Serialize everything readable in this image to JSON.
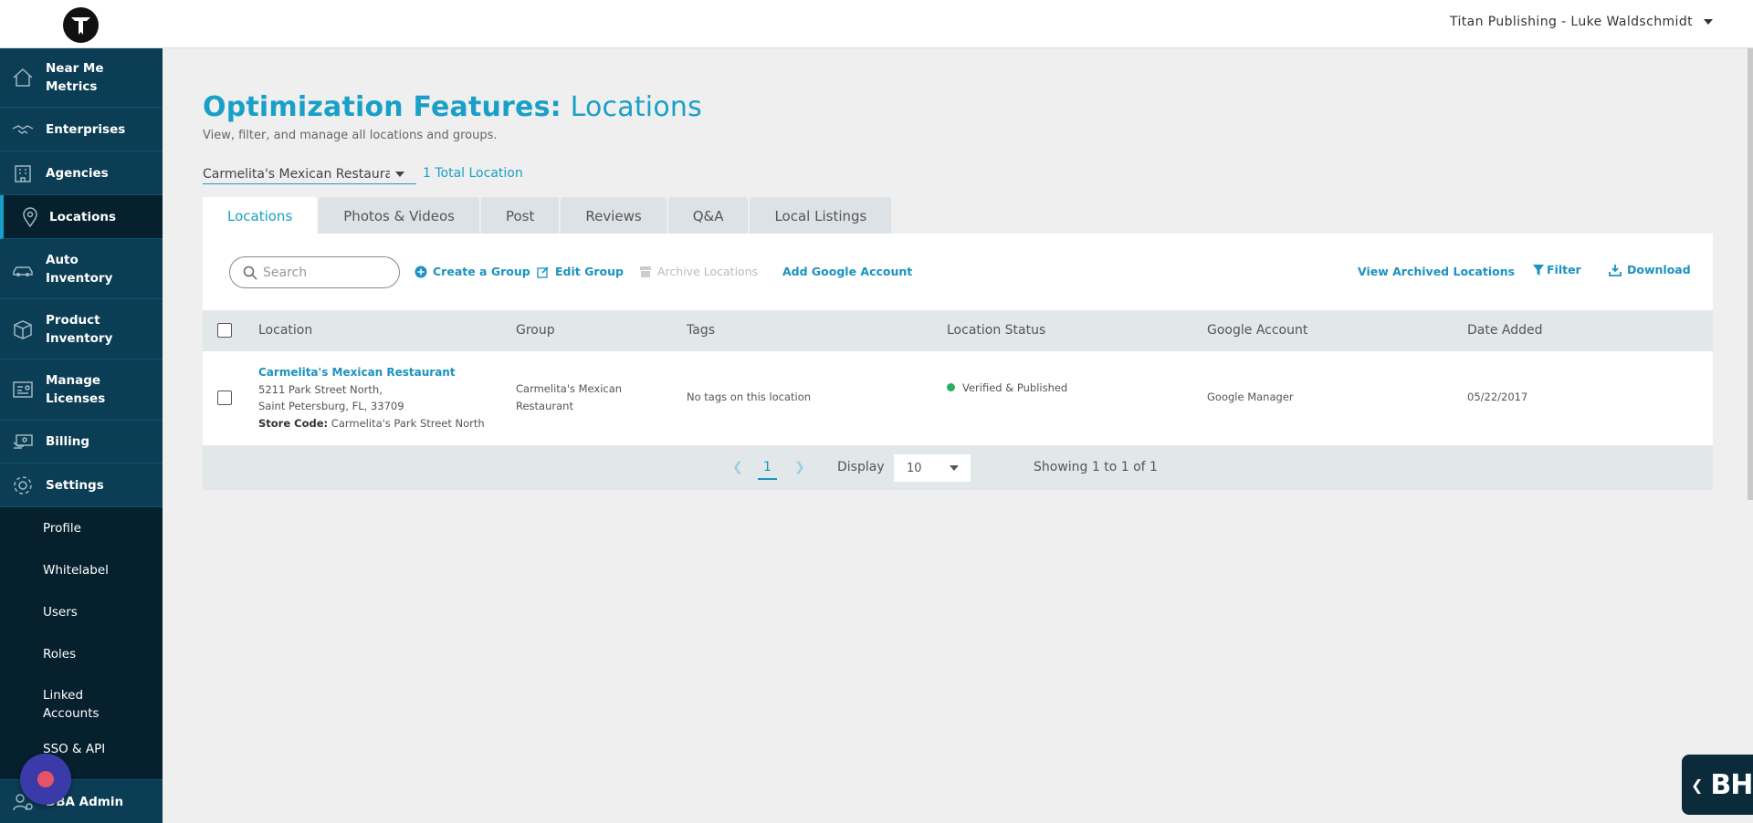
{
  "header": {
    "account": "Titan Publishing - Luke Waldschmidt"
  },
  "sidebar": {
    "items": [
      {
        "label": "Near Me Metrics",
        "icon": "house-icon"
      },
      {
        "label": "Enterprises",
        "icon": "handshake-icon"
      },
      {
        "label": "Agencies",
        "icon": "building-icon"
      },
      {
        "label": "Locations",
        "icon": "map-pin-icon"
      },
      {
        "label": "Auto Inventory",
        "icon": "car-icon"
      },
      {
        "label": "Product Inventory",
        "icon": "box-icon"
      },
      {
        "label": "Manage Licenses",
        "icon": "license-icon"
      },
      {
        "label": "Billing",
        "icon": "billing-icon"
      },
      {
        "label": "Settings",
        "icon": "gear-icon"
      }
    ],
    "sub_items": [
      "Profile",
      "Whitelabel",
      "Users",
      "Roles",
      "Linked Accounts",
      "SSO & API"
    ],
    "bottom": "DBA Admin"
  },
  "page": {
    "title_bold": "Optimization Features:",
    "title_light": "Locations",
    "subtitle": "View, filter, and manage all locations and groups.",
    "group_select": "Carmelita's Mexican Restaurant",
    "total": "1 Total Location"
  },
  "tabs": [
    "Locations",
    "Photos & Videos",
    "Post",
    "Reviews",
    "Q&A",
    "Local Listings"
  ],
  "toolbar": {
    "search_placeholder": "Search",
    "create_group": "Create a Group",
    "edit_group": "Edit Group",
    "archive": "Archive Locations",
    "add_google": "Add Google Account",
    "view_archived": "View Archived Locations",
    "filter": "Filter",
    "download": "Download"
  },
  "table": {
    "headers": [
      "Location",
      "Group",
      "Tags",
      "Location Status",
      "Google Account",
      "Date Added"
    ],
    "rows": [
      {
        "name": "Carmelita's Mexican Restaurant",
        "address1": "5211 Park Street North,",
        "address2": "Saint Petersburg, FL, 33709",
        "store_code_label": "Store Code:",
        "store_code": "Carmelita's Park Street North",
        "group_line1": "Carmelita's Mexican",
        "group_line2": "Restaurant",
        "tags": "No tags on this location",
        "status": "Verified & Published",
        "google_account": "Google Manager",
        "date_added": "05/22/2017"
      }
    ]
  },
  "pager": {
    "page": "1",
    "display_label": "Display",
    "display_value": "10",
    "showing": "Showing 1 to 1 of 1"
  },
  "widget": {
    "label": "BH."
  },
  "colors": {
    "accent": "#1aa0c8",
    "sidebar": "#0b3d54",
    "sidebar_dark": "#06202d",
    "status": "#27ae60"
  }
}
